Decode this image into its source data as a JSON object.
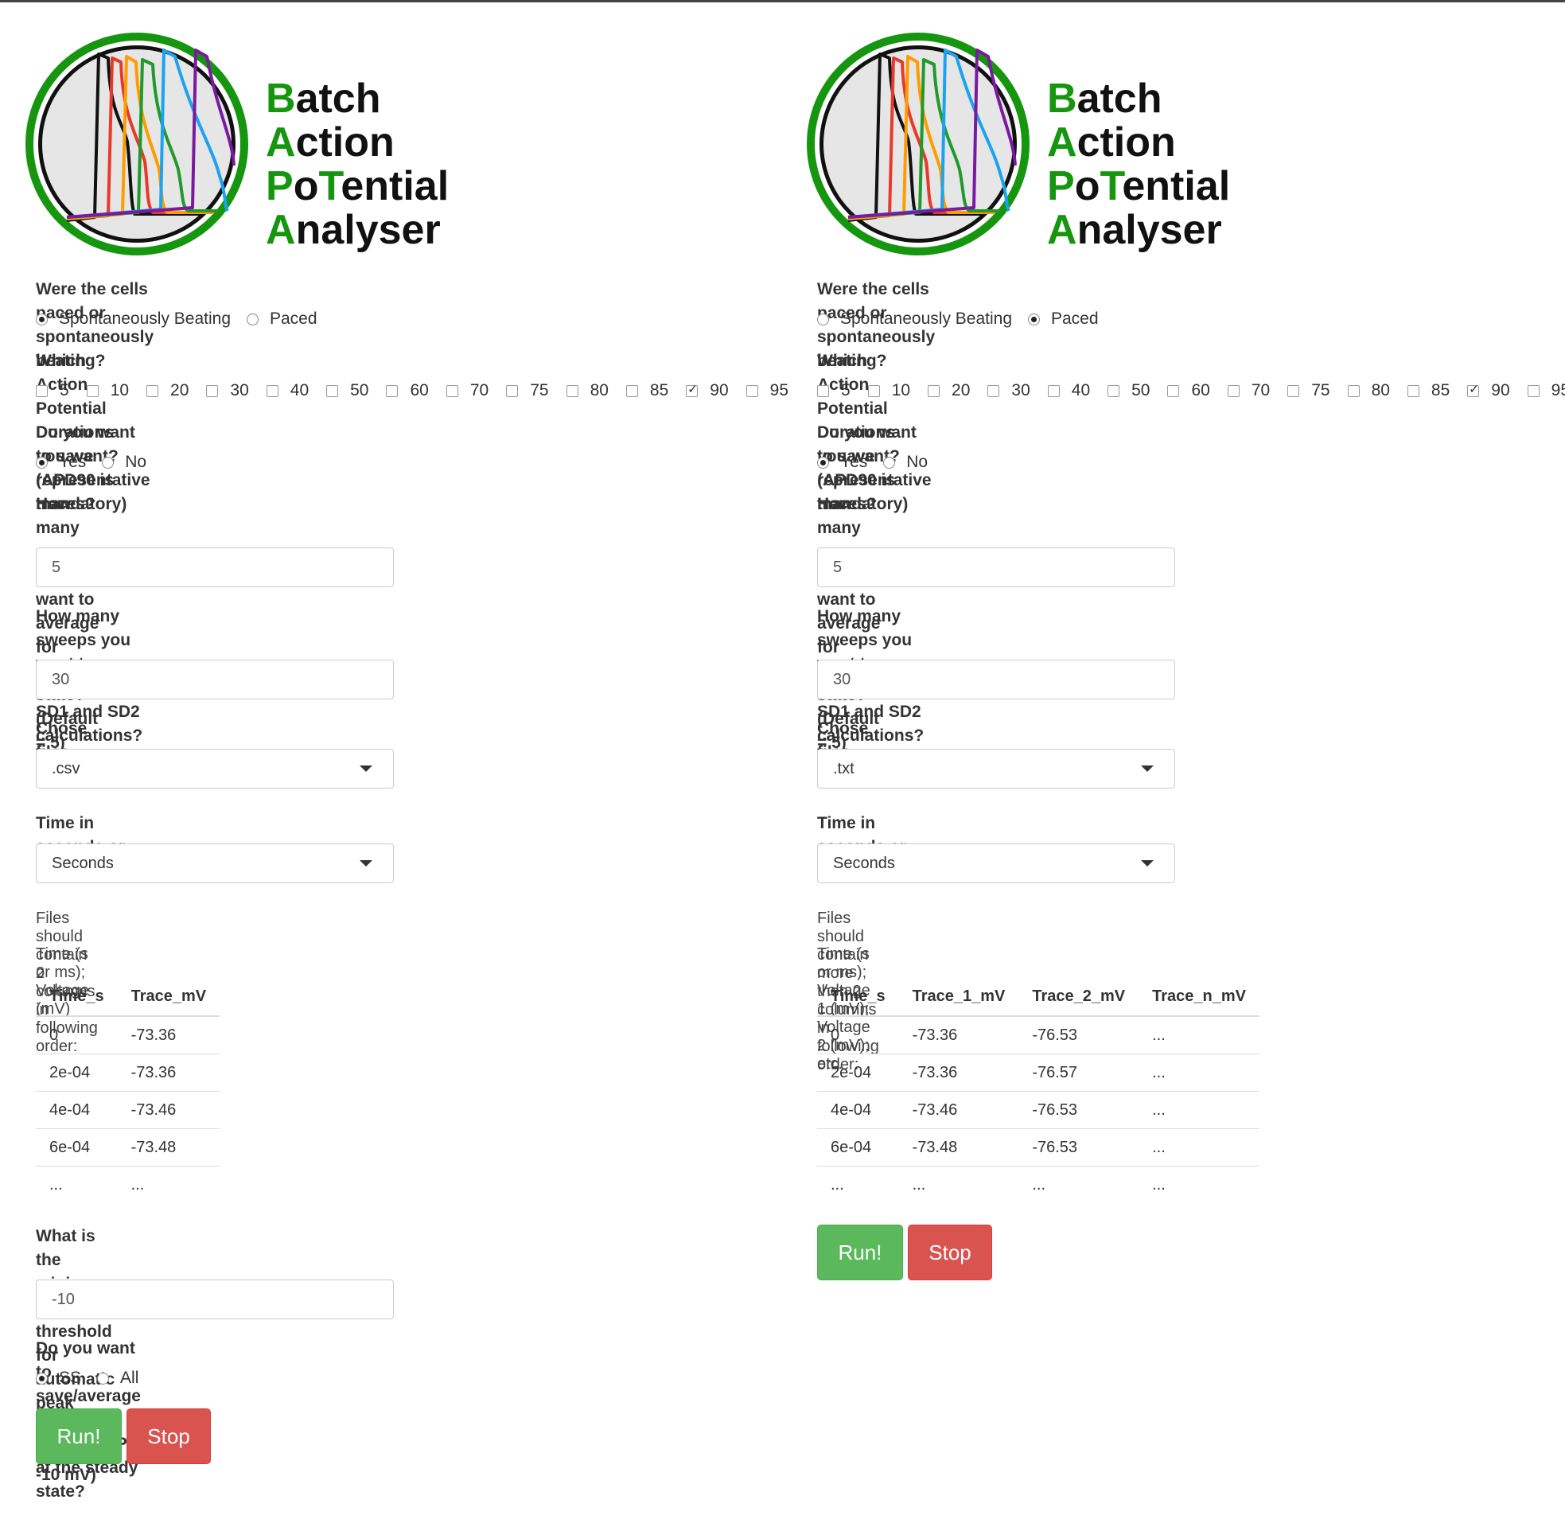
{
  "logo": {
    "lines": [
      {
        "cap": "B",
        "rest": "atch"
      },
      {
        "cap": "A",
        "rest": "ction"
      },
      {
        "cap": "P",
        "mid": "o",
        "cap2": "T",
        "rest": "ential"
      },
      {
        "cap": "A",
        "rest": "nalyser"
      }
    ],
    "colors": {
      "ring": "#16960f",
      "black": "#111111",
      "red": "#e8392a",
      "orange": "#ff9c00",
      "green": "#1f9a2b",
      "blue": "#1aa3ef",
      "purple": "#7a1aa0"
    }
  },
  "left": {
    "q_pacing": "Were the cells paced or spontaneously beating?",
    "pacing_options": [
      {
        "label": "Spontaneously Beating",
        "checked": true
      },
      {
        "label": "Paced",
        "checked": false
      }
    ],
    "q_apd": "Which Action Potential Durations you want? (APD90 is mandatory)",
    "apd_options": [
      {
        "label": "5",
        "checked": false
      },
      {
        "label": "10",
        "checked": false
      },
      {
        "label": "20",
        "checked": false
      },
      {
        "label": "30",
        "checked": false
      },
      {
        "label": "40",
        "checked": false
      },
      {
        "label": "50",
        "checked": false
      },
      {
        "label": "60",
        "checked": false
      },
      {
        "label": "70",
        "checked": false
      },
      {
        "label": "75",
        "checked": false
      },
      {
        "label": "80",
        "checked": false
      },
      {
        "label": "85",
        "checked": false
      },
      {
        "label": "90",
        "checked": true
      },
      {
        "label": "95",
        "checked": false
      }
    ],
    "q_traces": "Do you want to save representative traces?",
    "traces_options": [
      {
        "label": "Yes",
        "checked": true
      },
      {
        "label": "No",
        "checked": false
      }
    ],
    "q_sweeps_ss_1": "How many sweeps you want to average for",
    "q_sweeps_ss_2": "steady state? (Default = 5)",
    "sweeps_ss_value": "5",
    "q_sweeps_sd_1": "How many sweeps you want to average for",
    "q_sweeps_sd_2": "SD1 and SD2 calculations? (Default = 30)",
    "sweeps_sd_value": "30",
    "q_format": "Chose files format",
    "format_value": ".csv",
    "q_time": "Time in seconds or miliseconds?",
    "time_value": "Seconds",
    "note1": "Files should contain 2 columns in following order:",
    "note2": "Time (s or ms); Voltage (mV)",
    "table": {
      "headers": [
        "Time_s",
        "Trace_mV"
      ],
      "rows": [
        [
          "0",
          "-73.36"
        ],
        [
          "2e-04",
          "-73.36"
        ],
        [
          "4e-04",
          "-73.46"
        ],
        [
          "6e-04",
          "-73.48"
        ],
        [
          "...",
          "..."
        ]
      ]
    },
    "q_threshold_1": "What is the minimum voltage threshold for",
    "q_threshold_2": "automatic peak detection? (Default = -10 mV)",
    "threshold_value": "-10",
    "q_save_all": "Do you want to save/average all data or only the APs at the steady state?",
    "save_all_options": [
      {
        "label": "SS",
        "checked": true
      },
      {
        "label": "All",
        "checked": false
      }
    ],
    "run_label": "Run!",
    "stop_label": "Stop"
  },
  "right": {
    "q_pacing": "Were the cells paced or spontaneously beating?",
    "pacing_options": [
      {
        "label": "Spontaneously Beating",
        "checked": false
      },
      {
        "label": "Paced",
        "checked": true
      }
    ],
    "q_apd": "Which Action Potential Durations you want? (APD90 is mandatory)",
    "apd_options": [
      {
        "label": "5",
        "checked": false
      },
      {
        "label": "10",
        "checked": false
      },
      {
        "label": "20",
        "checked": false
      },
      {
        "label": "30",
        "checked": false
      },
      {
        "label": "40",
        "checked": false
      },
      {
        "label": "50",
        "checked": false
      },
      {
        "label": "60",
        "checked": false
      },
      {
        "label": "70",
        "checked": false
      },
      {
        "label": "75",
        "checked": false
      },
      {
        "label": "80",
        "checked": false
      },
      {
        "label": "85",
        "checked": false
      },
      {
        "label": "90",
        "checked": true
      },
      {
        "label": "95",
        "checked": false
      }
    ],
    "q_traces": "Do you want to save representative traces?",
    "traces_options": [
      {
        "label": "Yes",
        "checked": true
      },
      {
        "label": "No",
        "checked": false
      }
    ],
    "q_sweeps_ss_1": "How many sweeps you want to average for",
    "q_sweeps_ss_2": "steady state? (Default = 5)",
    "sweeps_ss_value": "5",
    "q_sweeps_sd_1": "How many sweeps you want to average for",
    "q_sweeps_sd_2": "SD1 and SD2 calculations? (Default = 30)",
    "sweeps_sd_value": "30",
    "q_format": "Chose files format",
    "format_value": ".txt",
    "q_time": "Time in seconds or miliseconds?",
    "time_value": "Seconds",
    "note1": "Files should contain more then 2 columns in following order:",
    "note2": "Time (s or ms); Voltage 1 (mV); Voltage 2 (mV); etc.",
    "table": {
      "headers": [
        "Time_s",
        "Trace_1_mV",
        "Trace_2_mV",
        "Trace_n_mV"
      ],
      "rows": [
        [
          "0",
          "-73.36",
          "-76.53",
          "..."
        ],
        [
          "2e-04",
          "-73.36",
          "-76.57",
          "..."
        ],
        [
          "4e-04",
          "-73.46",
          "-76.53",
          "..."
        ],
        [
          "6e-04",
          "-73.48",
          "-76.53",
          "..."
        ],
        [
          "...",
          "...",
          "...",
          "..."
        ]
      ]
    },
    "run_label": "Run!",
    "stop_label": "Stop"
  }
}
